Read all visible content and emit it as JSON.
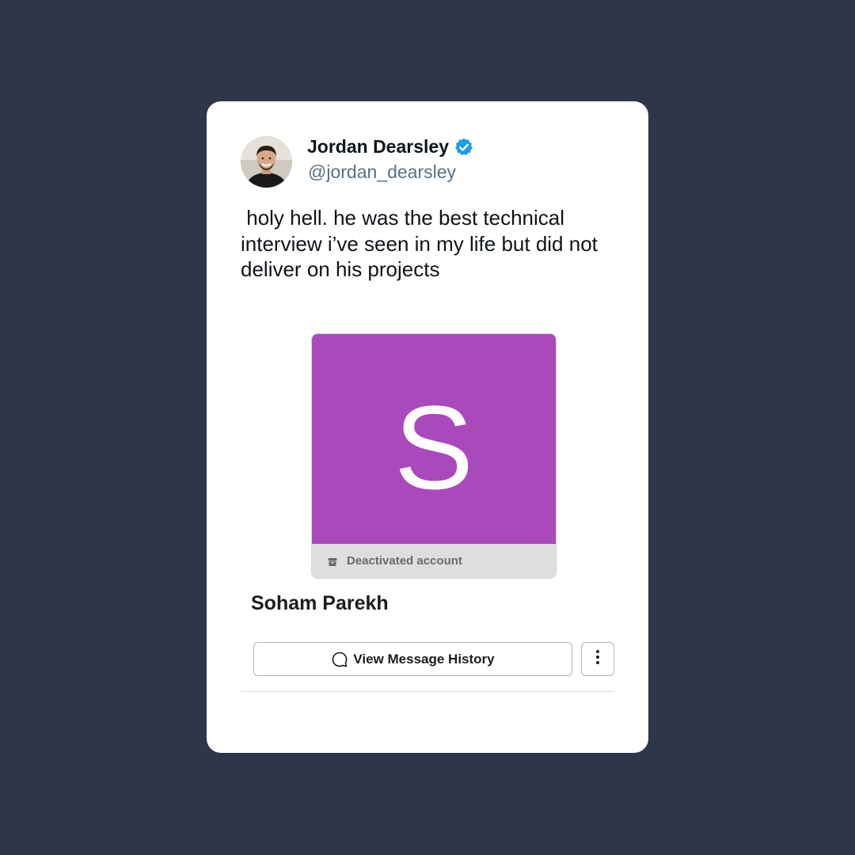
{
  "author": {
    "name": "Jordan Dearsley",
    "handle": "@jordan_dearsley",
    "verified": true,
    "avatar_icon": "person-photo-avatar"
  },
  "tweet": {
    "text": " holy hell. he was the best technical\ninterview i’ve seen in my life but did not\ndeliver on his projects"
  },
  "embedded_profile": {
    "initial": "S",
    "tile_color": "#aa49bb",
    "status": "Deactivated account",
    "status_icon": "archive-icon",
    "name": "Soham Parekh",
    "view_history_label": "View Message History",
    "view_history_icon": "speech-bubble-icon",
    "more_icon": "kebab-menu-icon"
  },
  "colors": {
    "background": "#2e3649",
    "card": "#ffffff",
    "verified_badge": "#1d9bf0",
    "handle_text": "#5b7083"
  }
}
